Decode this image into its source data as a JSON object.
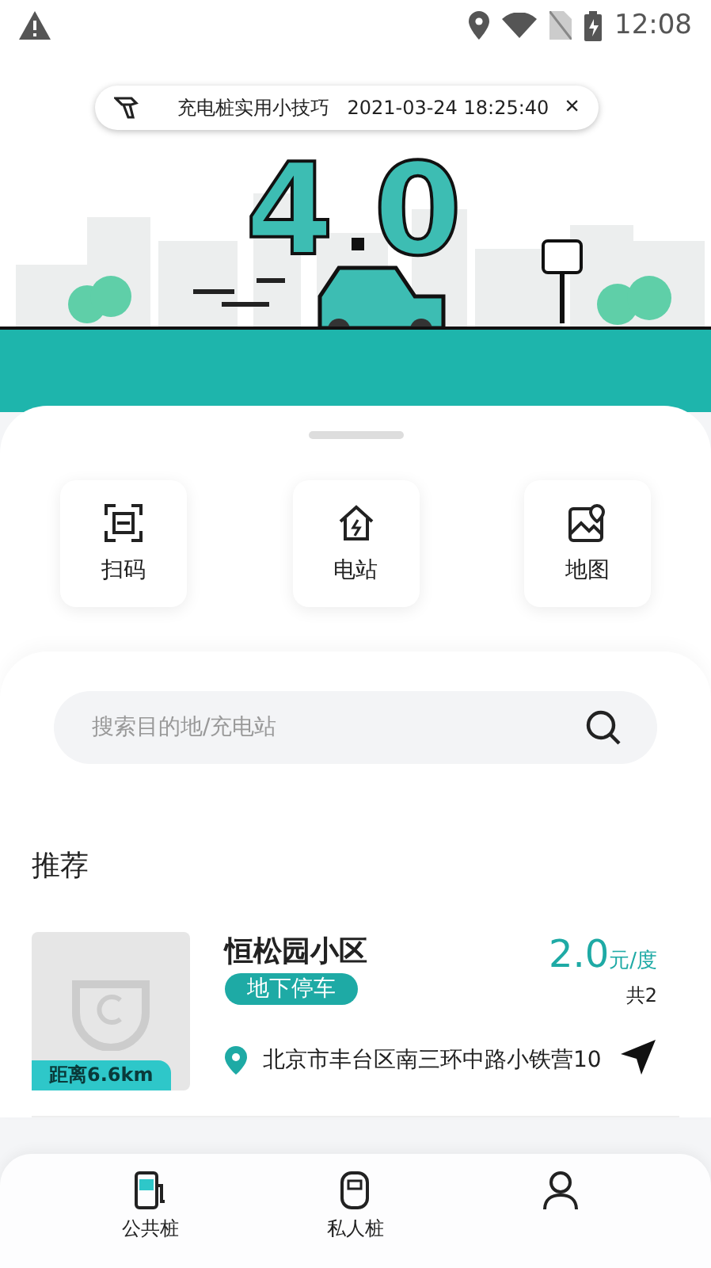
{
  "status_bar": {
    "time": "12:08"
  },
  "hero_digits": [
    "4",
    "0"
  ],
  "notification": {
    "title": "充电桩实用小技巧",
    "time": "2021-03-24 18:25:40",
    "close": "×"
  },
  "quick_actions": [
    {
      "kind": "scan",
      "label": "扫码"
    },
    {
      "kind": "station",
      "label": "电站"
    },
    {
      "kind": "map",
      "label": "地图"
    }
  ],
  "search": {
    "placeholder": "搜索目的地/充电站"
  },
  "section_title": "推荐",
  "stations": [
    {
      "name": "恒松园小区",
      "tag": "地下停车",
      "distance": "距离6.6km",
      "price": "2.0",
      "unit": "元/度",
      "count": "共2",
      "address": "北京市丰台区南三环中路小铁营10"
    }
  ],
  "bottom_nav": [
    {
      "kind": "public",
      "label": "公共桩"
    },
    {
      "kind": "private",
      "label": "私人桩"
    },
    {
      "kind": "profile"
    }
  ]
}
